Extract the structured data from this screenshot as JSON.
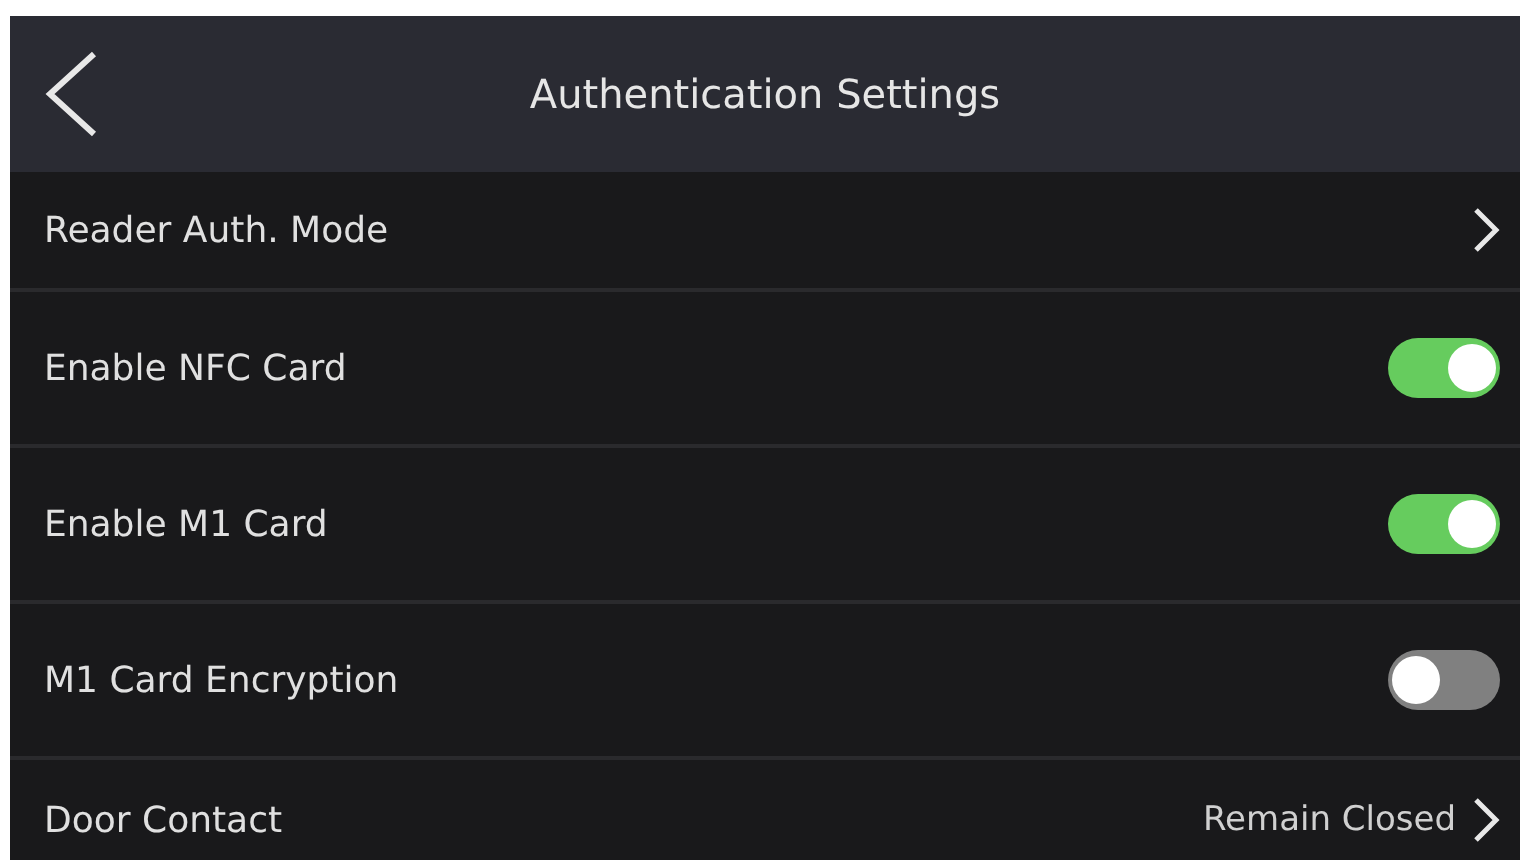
{
  "header": {
    "title": "Authentication Settings"
  },
  "rows": [
    {
      "kind": "link",
      "label": "Reader Auth. Mode"
    },
    {
      "kind": "toggle",
      "label": "Enable NFC Card",
      "on": true
    },
    {
      "kind": "toggle",
      "label": "Enable M1 Card",
      "on": true
    },
    {
      "kind": "toggle",
      "label": "M1 Card Encryption",
      "on": false
    },
    {
      "kind": "link",
      "label": "Door Contact",
      "value": "Remain Closed"
    }
  ]
}
